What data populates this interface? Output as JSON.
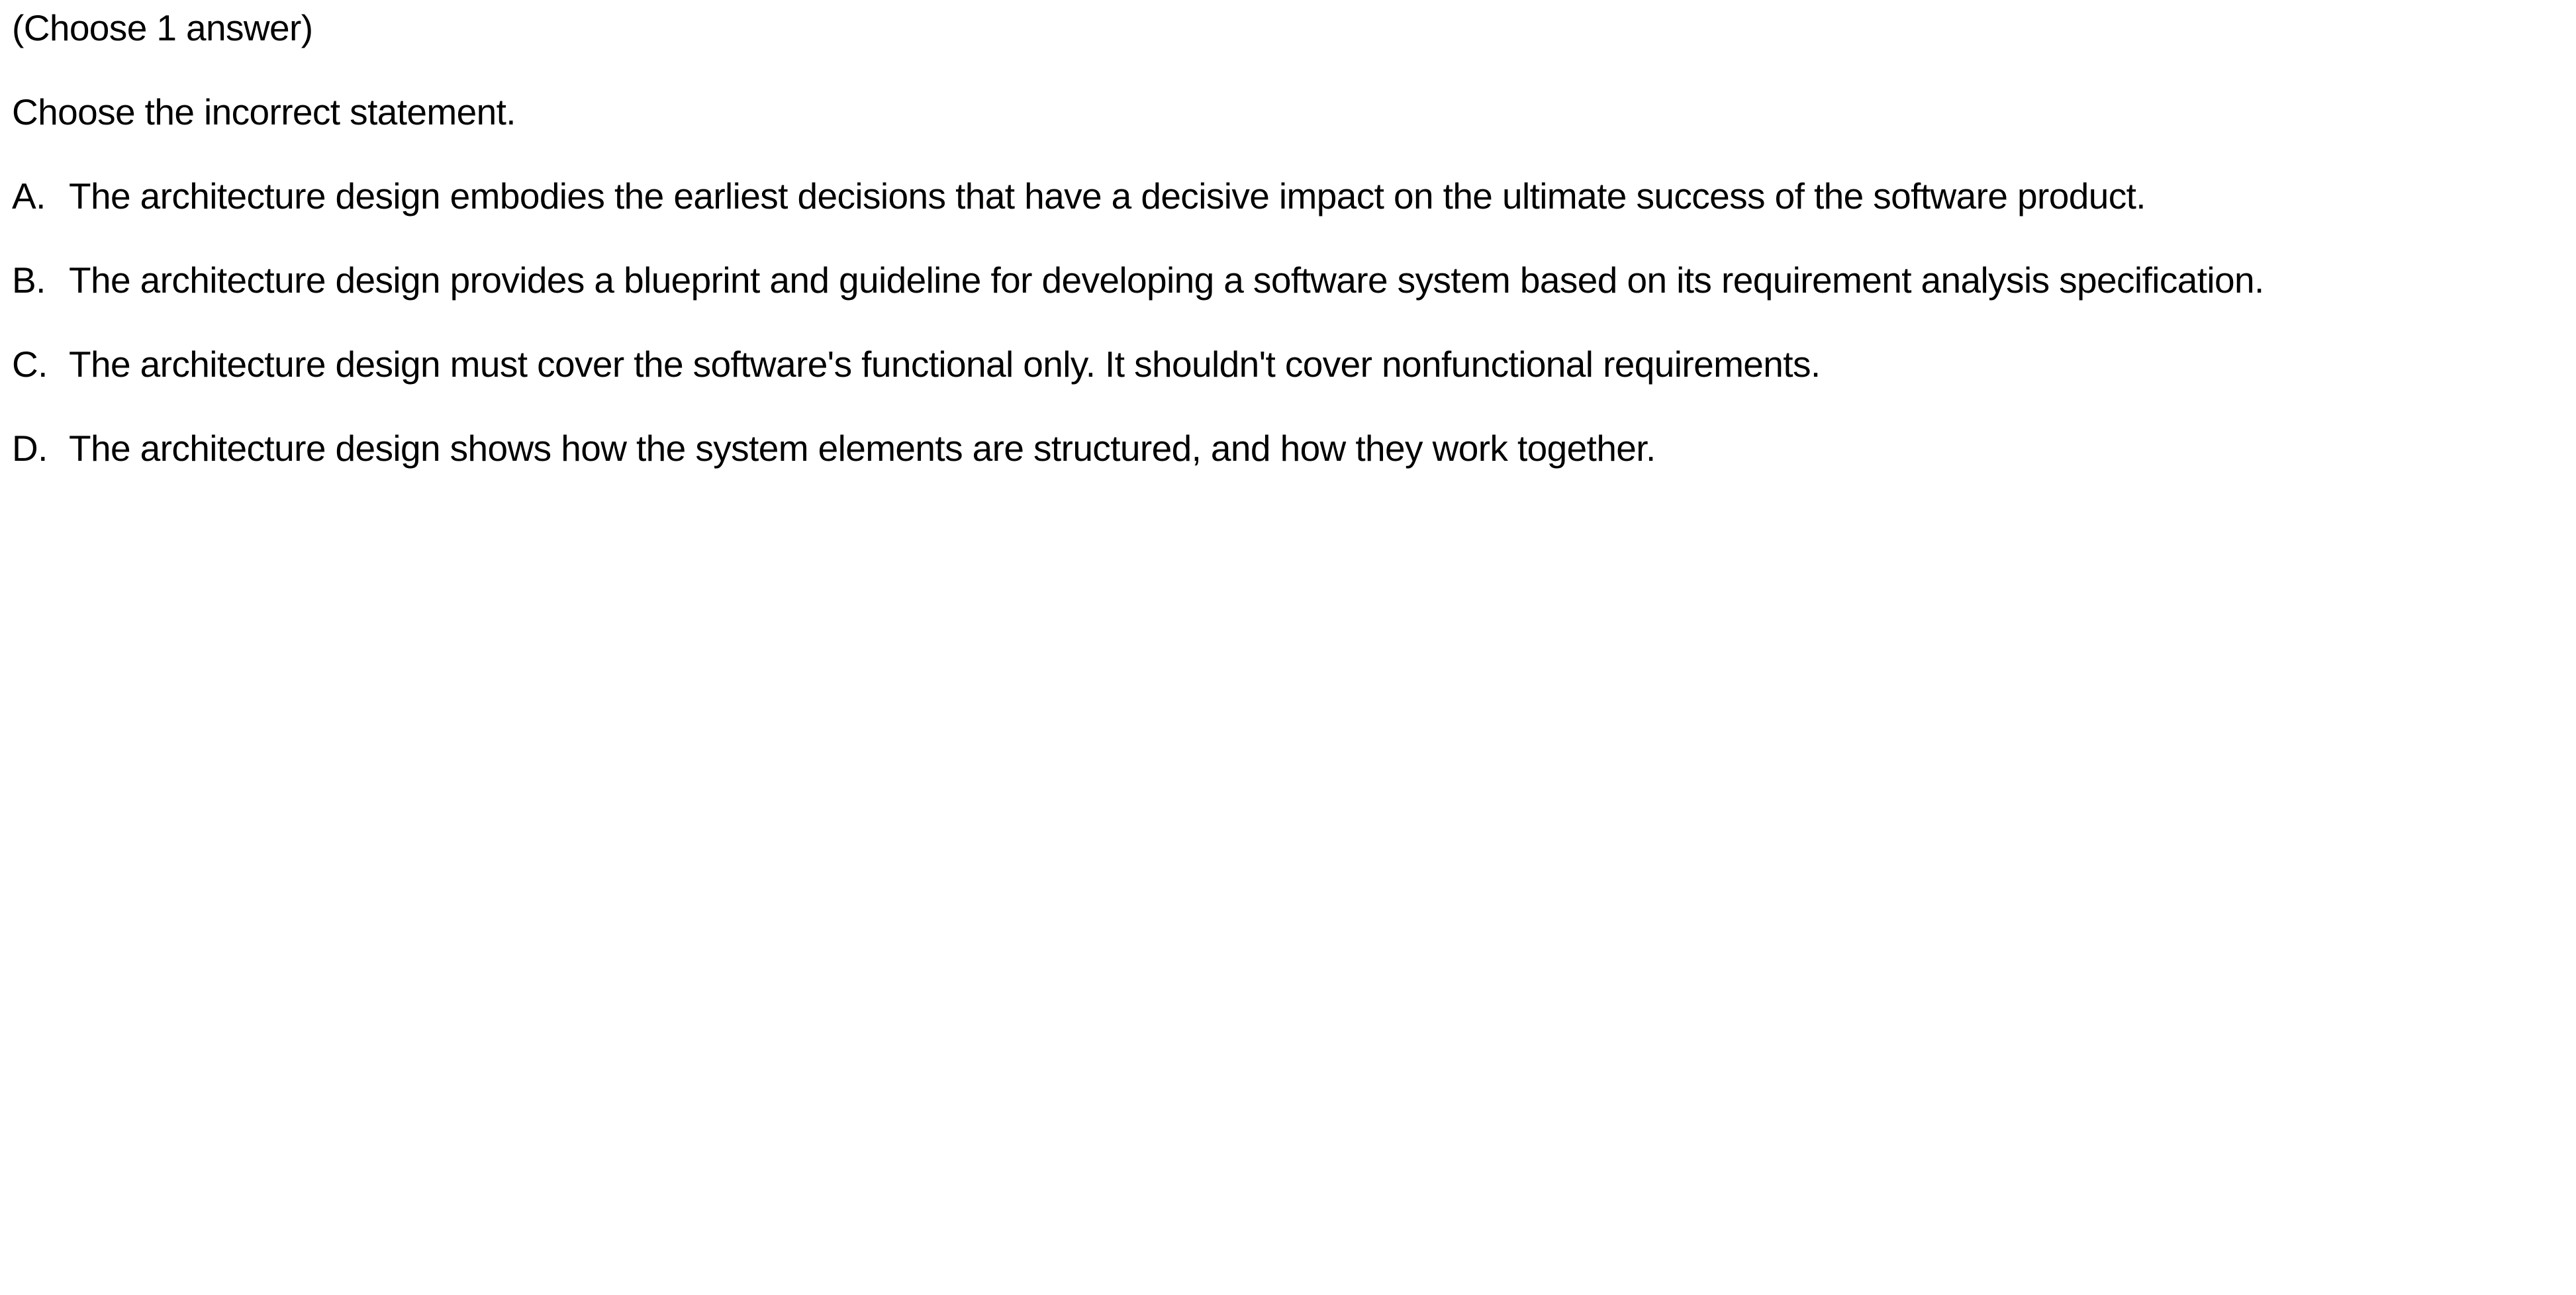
{
  "instruction": "(Choose 1 answer)",
  "question": "Choose the incorrect statement.",
  "options": [
    {
      "letter": "A.",
      "text": "The architecture design embodies the earliest decisions that have a decisive impact on the ultimate success of the software product."
    },
    {
      "letter": "B.",
      "text": "The architecture design provides a blueprint and guideline for developing a software system based on its requirement analysis specification."
    },
    {
      "letter": "C.",
      "text": "The architecture design must cover the software's functional only. It shouldn't cover nonfunctional requirements."
    },
    {
      "letter": "D.",
      "text": "The architecture design shows how the system elements are structured, and how they work together."
    }
  ]
}
